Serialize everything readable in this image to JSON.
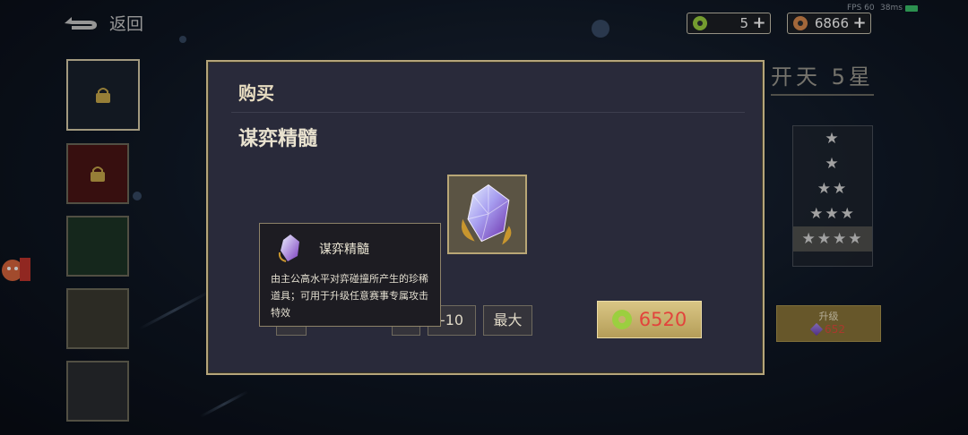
{
  "topbar": {
    "back_label": "返回",
    "fps": "FPS 60",
    "ping": "38ms",
    "currencies": [
      {
        "value": "5",
        "icon": "jade-coin-icon",
        "color": "#9bcf3f"
      },
      {
        "value": "6866",
        "icon": "copper-coin-icon",
        "color": "#d98a4e"
      }
    ]
  },
  "background": {
    "title_peek": "开天 5星",
    "stars": [
      "★",
      "★",
      "★★",
      "★★★",
      "★★★★"
    ],
    "upgrade": {
      "label": "升级",
      "cost": "652"
    }
  },
  "dialog": {
    "title": "购买",
    "item_name": "谋弈精髓",
    "quantity_partial": "-10",
    "max_label": "最大",
    "price": "6520",
    "accent": "#b5a57a"
  },
  "tooltip": {
    "name": "谋弈精髓",
    "description": "由主公高水平对弈碰撞所产生的珍稀道具；可用于升级任意赛事专属攻击特效"
  }
}
